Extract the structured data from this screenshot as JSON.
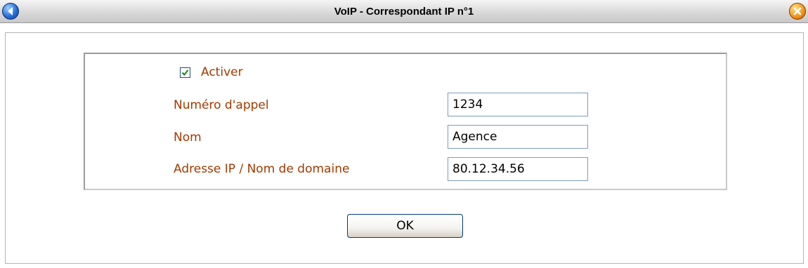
{
  "window": {
    "title": "VoIP - Correspondant IP n°1"
  },
  "form": {
    "enable": {
      "label": "Activer",
      "checked": true
    },
    "fields": [
      {
        "label": "Numéro d'appel",
        "value": "1234"
      },
      {
        "label": "Nom",
        "value": "Agence"
      },
      {
        "label": "Adresse IP / Nom de domaine",
        "value": "80.12.34.56"
      }
    ]
  },
  "actions": {
    "ok_label": "OK"
  },
  "icons": {
    "back": "back-arrow-icon",
    "close": "close-icon"
  },
  "colors": {
    "label": "#a23a00",
    "title_bar": "#d9d9d9",
    "checkmark": "#1e8a1e"
  }
}
